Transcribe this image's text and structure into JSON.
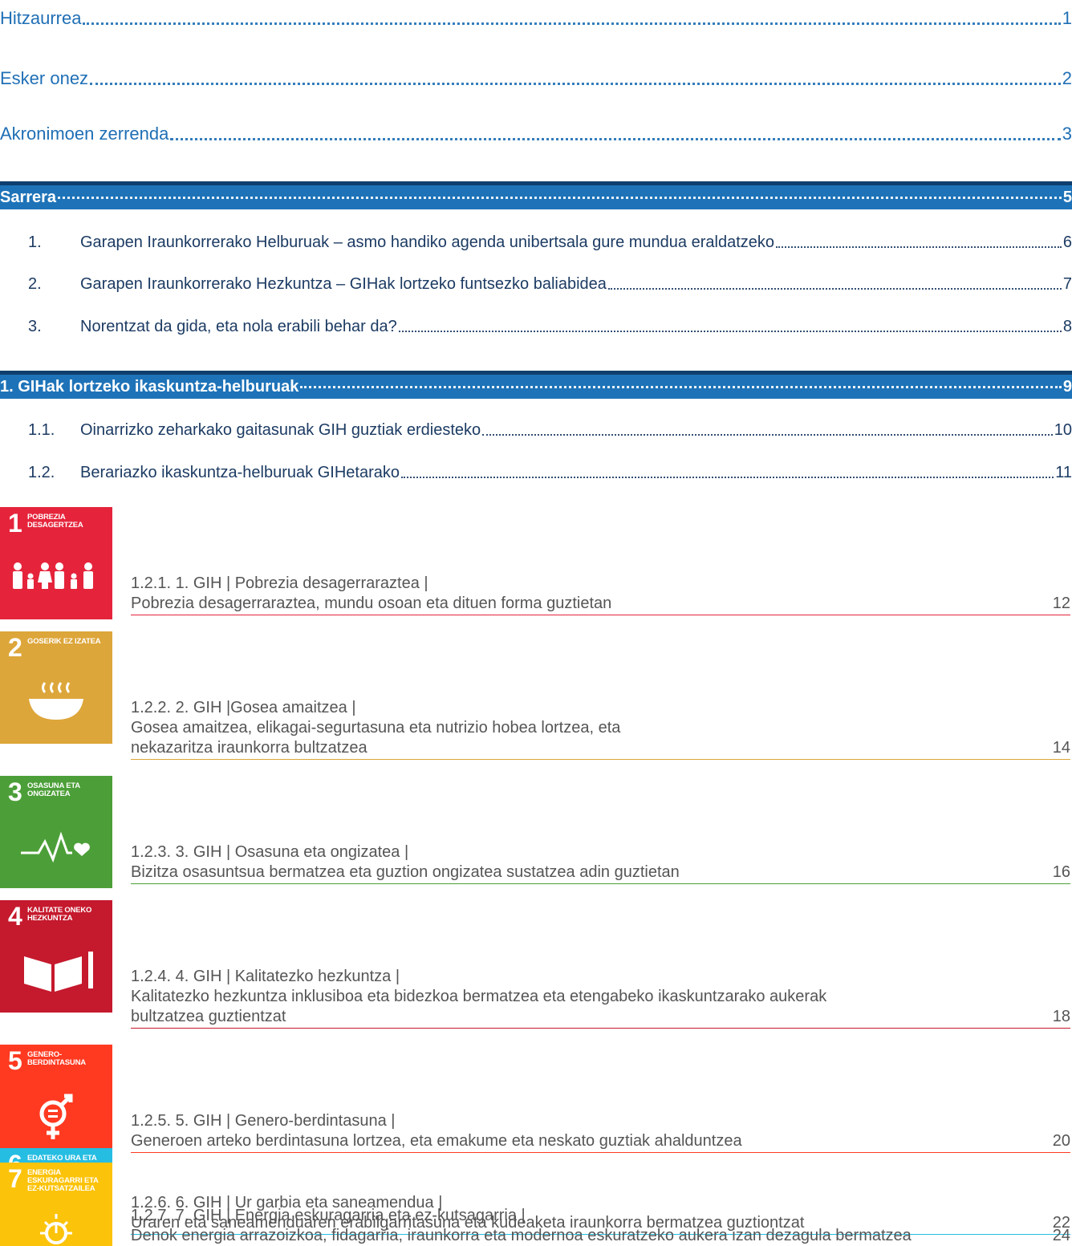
{
  "top_entries": [
    {
      "title": "Hitzaurrea",
      "page": "1"
    },
    {
      "title": "Esker onez",
      "page": "2"
    },
    {
      "title": "Akronimoen zerrenda",
      "page": "3"
    }
  ],
  "sections": [
    {
      "title": "Sarrera",
      "page": "5",
      "items": [
        {
          "num": "1.",
          "title": "Garapen Iraunkorrerako Helburuak – asmo handiko agenda unibertsala gure mundua eraldatzeko",
          "page": "6"
        },
        {
          "num": "2.",
          "title": "Garapen Iraunkorrerako Hezkuntza – GIHak lortzeko funtsezko baliabidea",
          "page": "7"
        },
        {
          "num": "3.",
          "title": "Norentzat da gida, eta nola erabili behar da?",
          "page": "8"
        }
      ]
    },
    {
      "title": "1. GIHak lortzeko ikaskuntza-helburuak",
      "page": "9",
      "items": [
        {
          "num": "1.1.",
          "title": "Oinarrizko zeharkako gaitasunak GIH guztiak erdiesteko",
          "page": "10"
        },
        {
          "num": "1.2.",
          "title": "Berariazko ikaskuntza-helburuak GIHetarako",
          "page": "11"
        }
      ]
    }
  ],
  "goals": [
    {
      "tile_num": "1",
      "tile_title": "POBREZIA DESAGERTZEA",
      "color": "#e5243b",
      "icon": "family-icon",
      "heading": "1.2.1. 1. GIH | Pobrezia desagerraraztea |",
      "lines": [
        "Pobrezia desagerraraztea, mundu osoan eta dituen forma guztietan"
      ],
      "page": "12"
    },
    {
      "tile_num": "2",
      "tile_title": "GOSERIK EZ IZATEA",
      "color": "#dda63a",
      "icon": "bowl-icon",
      "heading": "1.2.2. 2. GIH |Gosea amaitzea |",
      "lines": [
        "Gosea amaitzea, elikagai-segurtasuna eta nutrizio hobea lortzea, eta",
        "nekazaritza iraunkorra bultzatzea"
      ],
      "page": "14"
    },
    {
      "tile_num": "3",
      "tile_title": "OSASUNA ETA ONGIZATEA",
      "color": "#4c9f38",
      "icon": "heartbeat-icon",
      "heading": "1.2.3. 3. GIH | Osasuna eta ongizatea |",
      "lines": [
        "Bizitza osasuntsua bermatzea eta guztion ongizatea sustatzea adin guztietan"
      ],
      "page": "16"
    },
    {
      "tile_num": "4",
      "tile_title": "KALITATE ONEKO HEZKUNTZA",
      "color": "#c5192d",
      "icon": "book-icon",
      "heading": "1.2.4. 4. GIH | Kalitatezko hezkuntza |",
      "lines": [
        "Kalitatezko hezkuntza inklusiboa eta bidezkoa bermatzea eta etengabeko ikaskuntzarako aukerak",
        "bultzatzea guztientzat"
      ],
      "page": "18"
    },
    {
      "tile_num": "5",
      "tile_title": "GENERO-BERDINTASUNA",
      "color": "#ff3a21",
      "icon": "gender-icon",
      "heading": "1.2.5. 5. GIH | Genero-berdintasuna |",
      "lines": [
        "Generoen arteko berdintasuna lortzea, eta emakume eta neskato guztiak ahalduntzea"
      ],
      "page": "20"
    },
    {
      "tile_num": "6",
      "tile_title": "EDATEKO URA ETA SANEAMENDUA",
      "color": "#26bde2",
      "icon": "water-icon",
      "heading": "1.2.6. 6. GIH | Ur garbia eta saneamendua |",
      "lines": [
        "Uraren eta saneamenduaren erabilgarritasuna eta kudeaketa iraunkorra bermatzea guztiontzat"
      ],
      "page": "22"
    },
    {
      "tile_num": "7",
      "tile_title": "ENERGIA ESKURAGARRI ETA EZ-KUTSATZAILEA",
      "color": "#fcc30b",
      "icon": "sun-power-icon",
      "heading": "1.2.7. 7. GIH | Energia eskuragarria eta ez-kutsagarria |",
      "lines": [
        "Denok energia arrazoizkoa, fidagarria, iraunkorra eta modernoa eskuratzeko aukera izan dezagula bermatzea"
      ],
      "page": "24"
    }
  ]
}
